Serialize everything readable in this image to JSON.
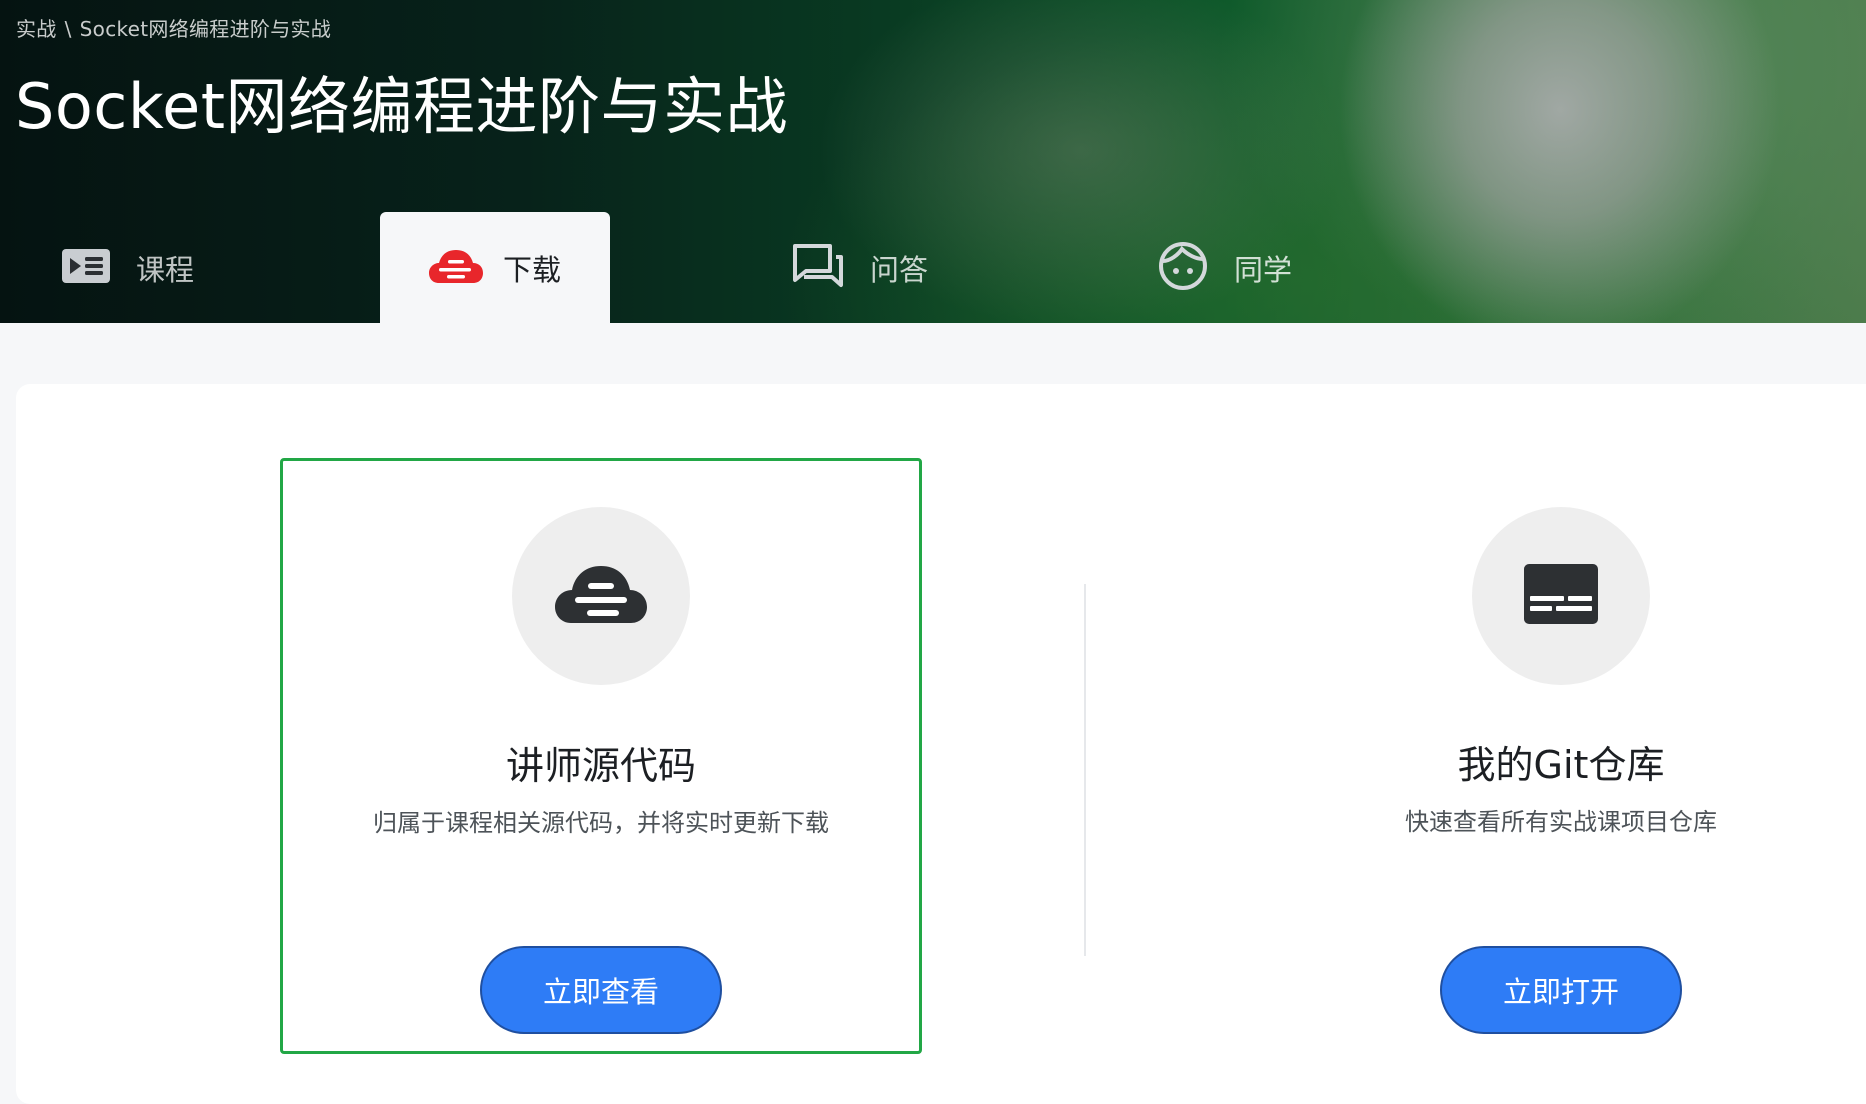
{
  "breadcrumb": {
    "items": [
      "实战",
      "Socket网络编程进阶与实战"
    ],
    "separator": "\\"
  },
  "page_title": "Socket网络编程进阶与实战",
  "tabs": [
    {
      "label": "课程",
      "icon": "video-list-icon",
      "active": false
    },
    {
      "label": "下载",
      "icon": "cloud-download-icon",
      "active": true
    },
    {
      "label": "问答",
      "icon": "chat-bubbles-icon",
      "active": false
    },
    {
      "label": "同学",
      "icon": "face-icon",
      "active": false
    }
  ],
  "cards": [
    {
      "title": "讲师源代码",
      "description": "归属于课程相关源代码，并将实时更新下载",
      "button": "立即查看",
      "icon": "cloud-code-icon",
      "selected": true
    },
    {
      "title": "我的Git仓库",
      "description": "快速查看所有实战课项目仓库",
      "button": "立即打开",
      "icon": "terminal-icon",
      "selected": false
    }
  ],
  "colors": {
    "accent_red": "#e8262b",
    "button_blue": "#2e7cf6",
    "selected_border": "#22a746"
  }
}
